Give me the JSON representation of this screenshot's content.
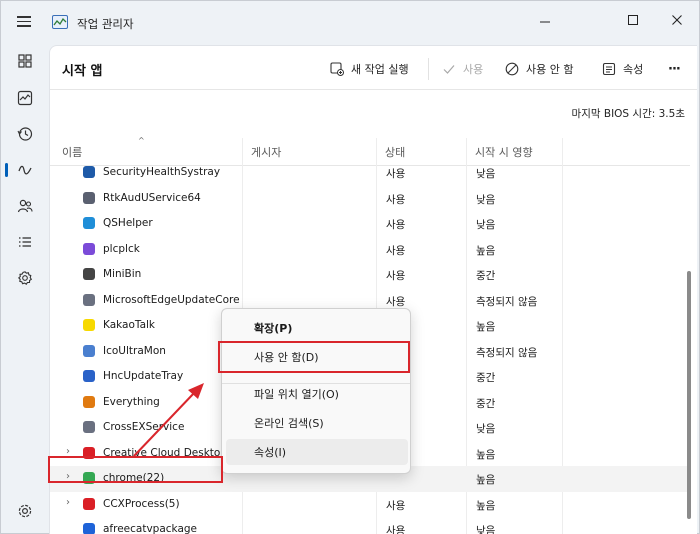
{
  "window": {
    "title": "작업 관리자",
    "controls": [
      "minimize",
      "maximize",
      "close"
    ]
  },
  "nav": {
    "items": [
      {
        "icon": "processes-icon"
      },
      {
        "icon": "performance-icon"
      },
      {
        "icon": "app-history-icon"
      },
      {
        "icon": "startup-apps-icon",
        "active": true
      },
      {
        "icon": "users-icon"
      },
      {
        "icon": "details-icon"
      },
      {
        "icon": "services-icon"
      }
    ],
    "settings_icon": "settings-icon"
  },
  "header": {
    "title": "시작 앱",
    "new_task": "새 작업 실행",
    "enable": "사용",
    "disable": "사용 안 함",
    "properties": "속성",
    "more": "···"
  },
  "bios_time": "마지막 BIOS 시간: 3.5초",
  "columns": {
    "name": "이름",
    "publisher": "게시자",
    "status": "상태",
    "impact": "시작 시 영향"
  },
  "rows": [
    {
      "name": "SecurityHealthSystray",
      "status": "사용",
      "impact": "낮음",
      "icon_color": "#1e5aa8",
      "partial": true
    },
    {
      "name": "RtkAudUService64",
      "status": "사용",
      "impact": "낮음",
      "icon_color": "#5a6070"
    },
    {
      "name": "QSHelper",
      "status": "사용",
      "impact": "낮음",
      "icon_color": "#1f8ed8"
    },
    {
      "name": "plcplck",
      "status": "사용",
      "impact": "높음",
      "icon_color": "#7b4bd8"
    },
    {
      "name": "MiniBin",
      "status": "사용",
      "impact": "중간",
      "icon_color": "#444444"
    },
    {
      "name": "MicrosoftEdgeUpdateCore",
      "status": "사용",
      "impact": "측정되지 않음",
      "icon_color": "#6a7080"
    },
    {
      "name": "KakaoTalk",
      "status": "",
      "impact": "높음",
      "icon_color": "#f7d900"
    },
    {
      "name": "IcoUltraMon",
      "status": "",
      "impact": "측정되지 않음",
      "icon_color": "#4a7fcf"
    },
    {
      "name": "HncUpdateTray",
      "status": "",
      "impact": "중간",
      "icon_color": "#2a62c8"
    },
    {
      "name": "Everything",
      "status": "",
      "impact": "중간",
      "icon_color": "#e07a10"
    },
    {
      "name": "CrossEXService",
      "status": "",
      "impact": "낮음",
      "icon_color": "#6a7080"
    },
    {
      "name": "Creative Cloud Desktop",
      "status": "",
      "impact": "높음",
      "icon_color": "#da1f26",
      "expandable": true
    },
    {
      "name": "chrome(22)",
      "status": "",
      "impact": "높음",
      "icon_color": "#34a853",
      "expandable": true,
      "selected": true
    },
    {
      "name": "CCXProcess(5)",
      "status": "사용",
      "impact": "높음",
      "icon_color": "#da1f26",
      "expandable": true
    },
    {
      "name": "afreecatvpackage",
      "status": "사용",
      "impact": "낮음",
      "icon_color": "#1e63d8"
    }
  ],
  "context_menu": {
    "items": [
      {
        "label": "확장(P)",
        "bold": true
      },
      {
        "label": "사용 안 함(D)"
      },
      {
        "label": "파일 위치 열기(O)"
      },
      {
        "label": "온라인 검색(S)"
      },
      {
        "label": "속성(I)"
      }
    ]
  },
  "colors": {
    "accent": "#005fb8",
    "highlight": "#d9262c",
    "window_bg": "#eef2f6"
  }
}
